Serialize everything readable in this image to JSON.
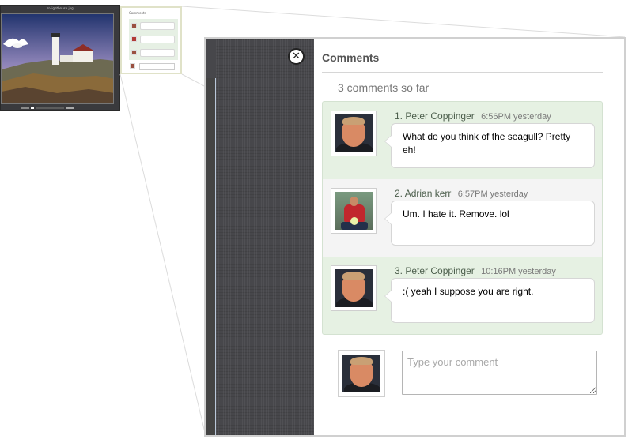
{
  "thumbnail": {
    "caption": "sr-lighthouse.jpg",
    "panel_title": "Comments"
  },
  "comments_panel": {
    "title": "Comments",
    "count_text": "3 comments so far",
    "close_icon": "close-circle-icon",
    "comments": [
      {
        "number": "1.",
        "author": "Peter Coppinger",
        "time": "6:56PM yesterday",
        "text": "What do you think of the seagull? Pretty eh!"
      },
      {
        "number": "2.",
        "author": "Adrian kerr",
        "time": "6:57PM yesterday",
        "text": "Um. I hate it. Remove. lol"
      },
      {
        "number": "3.",
        "author": "Peter Coppinger",
        "time": "10:16PM yesterday",
        "text": ":( yeah I suppose you are right."
      }
    ],
    "compose": {
      "placeholder": "Type your comment",
      "value": ""
    }
  },
  "colors": {
    "list_bg": "#e6f1e3",
    "alt_row_bg": "#f4f4f4",
    "dark_texture": "#47474b"
  }
}
